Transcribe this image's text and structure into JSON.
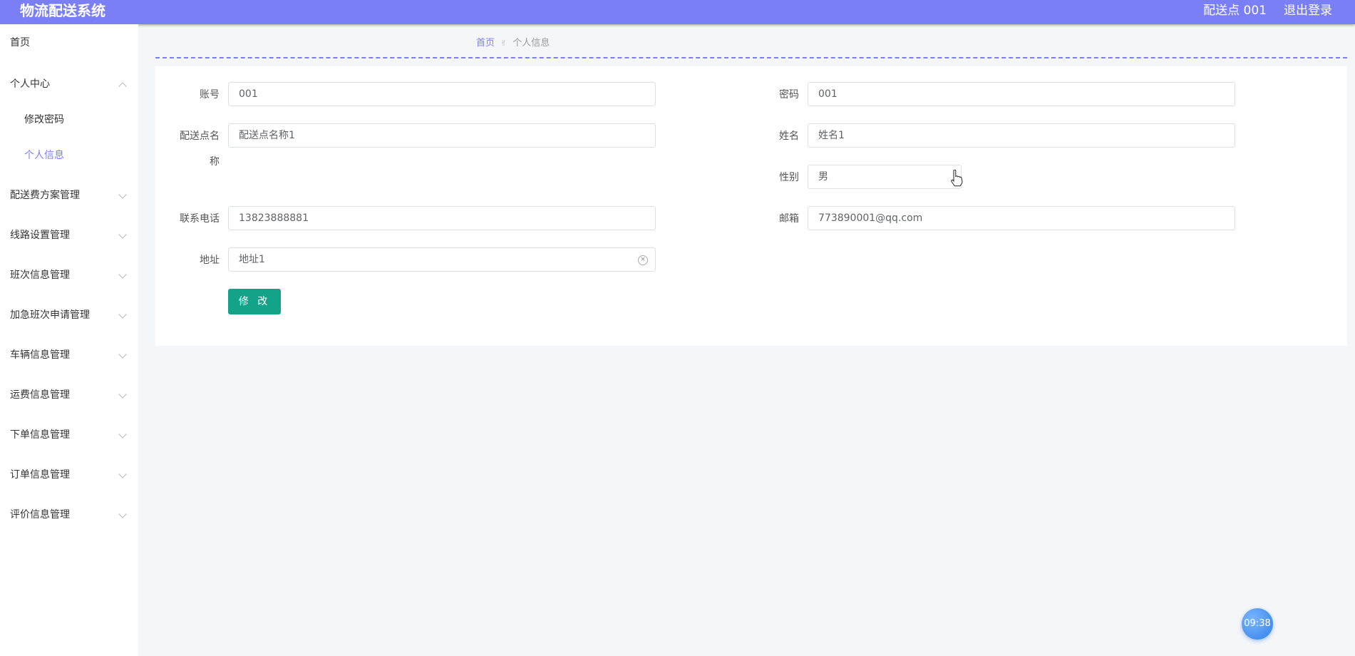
{
  "header": {
    "app_title": "物流配送系统",
    "user_label": "配送点 001",
    "logout_label": "退出登录"
  },
  "sidebar": {
    "items": [
      {
        "label": "首页"
      },
      {
        "label": "个人中心"
      },
      {
        "label": "修改密码"
      },
      {
        "label": "个人信息"
      },
      {
        "label": "配送费方案管理"
      },
      {
        "label": "线路设置管理"
      },
      {
        "label": "班次信息管理"
      },
      {
        "label": "加急班次申请管理"
      },
      {
        "label": "车辆信息管理"
      },
      {
        "label": "运费信息管理"
      },
      {
        "label": "下单信息管理"
      },
      {
        "label": "订单信息管理"
      },
      {
        "label": "评价信息管理"
      }
    ],
    "active_item": "个人信息"
  },
  "breadcrumb": {
    "home": "首页",
    "current": "个人信息"
  },
  "form": {
    "account": {
      "label": "账号",
      "value": "001"
    },
    "password": {
      "label": "密码",
      "value": "001"
    },
    "station_name": {
      "label_line1": "配送点名",
      "label_line2": "称",
      "value": "配送点名称1"
    },
    "name": {
      "label": "姓名",
      "value": "姓名1"
    },
    "gender": {
      "label": "性别",
      "value": "男"
    },
    "phone": {
      "label": "联系电话",
      "value": "13823888881"
    },
    "email": {
      "label": "邮箱",
      "value": "773890001@qq.com"
    },
    "address": {
      "label": "地址",
      "value": "地址1"
    },
    "submit_label": "修 改"
  },
  "clock": {
    "time": "09:38"
  },
  "colors": {
    "accent": "#7b7ff5",
    "button": "#14a289"
  }
}
